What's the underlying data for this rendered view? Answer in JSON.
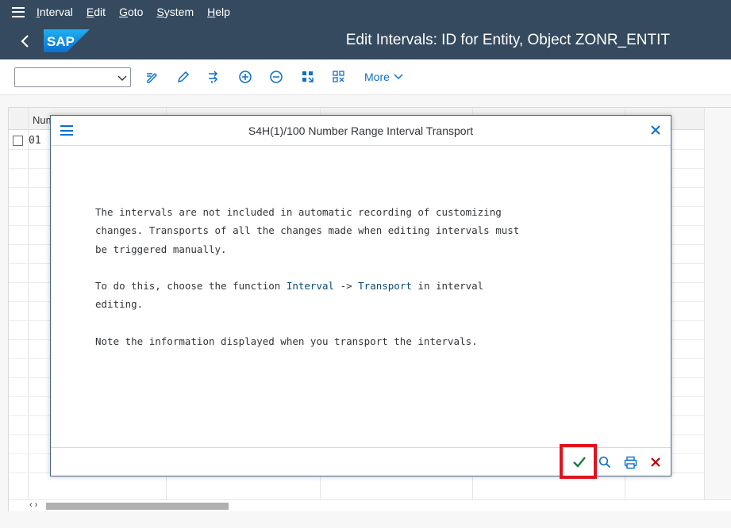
{
  "menubar": {
    "items": [
      "Interval",
      "Edit",
      "Goto",
      "System",
      "Help"
    ]
  },
  "titlebar": {
    "logo_text": "SAP",
    "title": "Edit Intervals: ID for Entity, Object ZONR_ENTIT"
  },
  "toolbar": {
    "combo_value": "",
    "more_label": "More"
  },
  "table": {
    "column_header": "Num",
    "rows": [
      {
        "value": "01"
      }
    ]
  },
  "dialog": {
    "title": "S4H(1)/100 Number Range Interval Transport",
    "paragraph1": "The intervals are not included in automatic recording of customizing\nchanges. Transports of all the changes made when editing intervals must\nbe triggered manually.",
    "p2_before": "To do this, choose the function ",
    "p2_link1": "Interval",
    "p2_mid": " -> ",
    "p2_link2": "Transport",
    "p2_after": " in interval\nediting.",
    "paragraph3": "Note the information displayed when you transport the intervals."
  },
  "colors": {
    "shell": "#354a5f",
    "accent": "#0a6ed1",
    "confirm": "#107e3e",
    "cancel": "#bb0000",
    "highlight": "#e0141e"
  }
}
